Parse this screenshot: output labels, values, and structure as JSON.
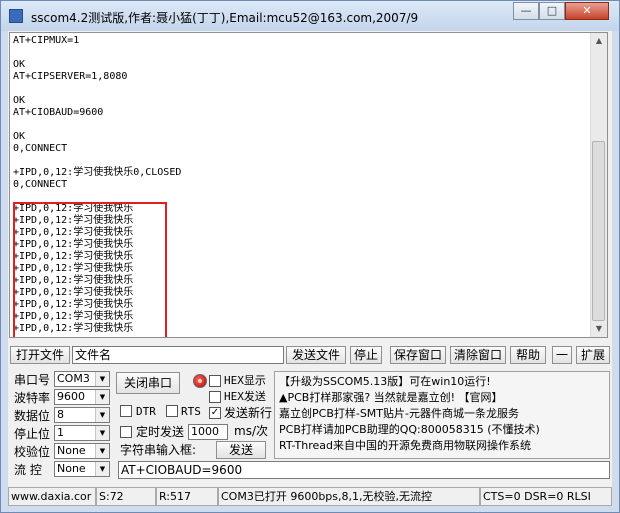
{
  "window": {
    "title": "sscom4.2测试版,作者:聂小猛(丁丁),Email:mcu52@163.com,2007/9",
    "minimize_glyph": "—",
    "maximize_glyph": "□",
    "close_glyph": "✕"
  },
  "terminal": {
    "lines": [
      "AT+CIPMUX=1",
      "",
      "OK",
      "AT+CIPSERVER=1,8080",
      "",
      "OK",
      "AT+CIOBAUD=9600",
      "",
      "OK",
      "0,CONNECT",
      "",
      "+IPD,0,12:学习使我快乐0,CLOSED",
      "0,CONNECT",
      "",
      "+IPD,0,12:学习使我快乐",
      "+IPD,0,12:学习使我快乐",
      "+IPD,0,12:学习使我快乐",
      "+IPD,0,12:学习使我快乐",
      "+IPD,0,12:学习使我快乐",
      "+IPD,0,12:学习使我快乐",
      "+IPD,0,12:学习使我快乐",
      "+IPD,0,12:学习使我快乐",
      "+IPD,0,12:学习使我快乐",
      "+IPD,0,12:学习使我快乐",
      "+IPD,0,12:学习使我快乐"
    ]
  },
  "file_row": {
    "open_file": "打开文件",
    "filename_value": "文件名",
    "send_file": "发送文件",
    "stop": "停止",
    "save_window": "保存窗口",
    "clear_window": "清除窗口",
    "help": "帮助",
    "dash": "一",
    "expand": "扩展"
  },
  "port_settings": {
    "port_label": "串口号",
    "port_value": "COM3",
    "baud_label": "波特率",
    "baud_value": "9600",
    "data_bits_label": "数据位",
    "data_bits_value": "8",
    "stop_bits_label": "停止位",
    "stop_bits_value": "1",
    "parity_label": "校验位",
    "parity_value": "None",
    "flow_label": "流 控",
    "flow_value": "None"
  },
  "controls": {
    "close_port": "关闭串口",
    "hex_display": "HEX显示",
    "hex_send": "HEX发送",
    "send_newline": "发送新行",
    "dtr": "DTR",
    "rts": "RTS",
    "timed_send": "定时发送",
    "interval_value": "1000",
    "interval_unit": "ms/次",
    "input_label": "字符串输入框:",
    "send": "发送",
    "send_newline_checked": true,
    "input_value": "AT+CIOBAUD=9600",
    "led_color": "#d40000"
  },
  "ad": {
    "lines": [
      "【升级为SSCOM5.13版】可在win10运行!",
      "▲PCB打样那家强? 当然就是嘉立创! 【官网】",
      "嘉立创PCB打样-SMT贴片-元器件商城一条龙服务",
      "PCB打样请加PCB助理的QQ:800058315 (不懂技术)",
      "RT-Thread来自中国的开源免费商用物联网操作系统"
    ]
  },
  "status": {
    "website": "www.daxia.cor",
    "sent": "S:72",
    "received": "R:517",
    "port_state": "COM3已打开  9600bps,8,1,无校验,无流控",
    "signals": "CTS=0 DSR=0 RLSI"
  }
}
